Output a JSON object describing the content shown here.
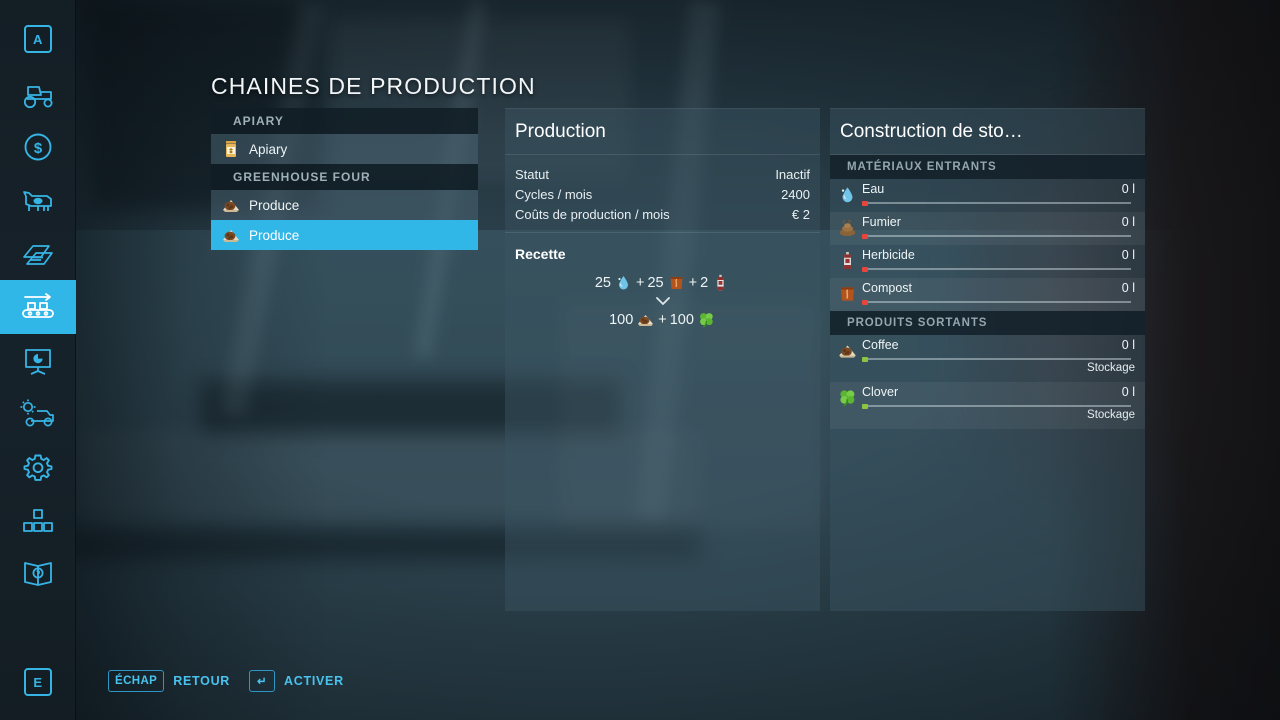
{
  "page": {
    "title": "CHAINES DE PRODUCTION"
  },
  "sidebar": {
    "items": [
      {
        "name": "map-key-a",
        "label": "A",
        "type": "key"
      },
      {
        "name": "vehicles-icon",
        "label": "",
        "type": "icon"
      },
      {
        "name": "finances-icon",
        "label": "",
        "type": "icon"
      },
      {
        "name": "animals-icon",
        "label": "",
        "type": "icon"
      },
      {
        "name": "contracts-icon",
        "label": "",
        "type": "icon"
      },
      {
        "name": "production-icon",
        "label": "",
        "type": "icon"
      },
      {
        "name": "statistics-icon",
        "label": "",
        "type": "icon"
      },
      {
        "name": "vehicle-config-icon",
        "label": "",
        "type": "icon"
      },
      {
        "name": "settings-icon",
        "label": "",
        "type": "icon"
      },
      {
        "name": "construction-icon",
        "label": "",
        "type": "icon"
      },
      {
        "name": "help-icon",
        "label": "",
        "type": "icon"
      },
      {
        "name": "map-key-e",
        "label": "E",
        "type": "key"
      }
    ],
    "active_index": 5,
    "accent": "#31b6e8"
  },
  "chain_list": [
    {
      "kind": "header",
      "label": "APIARY"
    },
    {
      "kind": "row",
      "label": "Apiary",
      "icon": "honey-jar-icon",
      "selected": false
    },
    {
      "kind": "header",
      "label": "GREENHOUSE FOUR"
    },
    {
      "kind": "row",
      "label": "Produce",
      "icon": "produce-icon",
      "selected": false
    },
    {
      "kind": "row",
      "label": "Produce",
      "icon": "produce-icon",
      "selected": true
    }
  ],
  "production": {
    "title": "Production",
    "stats": [
      {
        "label": "Statut",
        "value": "Inactif"
      },
      {
        "label": "Cycles / mois",
        "value": "2400"
      },
      {
        "label": "Coûts de production / mois",
        "value": "€ 2"
      }
    ],
    "recipe_title": "Recette",
    "recipe": {
      "inputs": [
        {
          "amount": "25",
          "icon": "water-drop-icon"
        },
        {
          "amount": "25",
          "icon": "compost-icon"
        },
        {
          "amount": "2",
          "icon": "herbicide-icon"
        }
      ],
      "outputs": [
        {
          "amount": "100",
          "icon": "coffee-icon"
        },
        {
          "amount": "100",
          "icon": "clover-icon"
        }
      ],
      "plus": "+",
      "arrow": "⌄"
    }
  },
  "storage": {
    "title": "Construction de sto…",
    "groups": [
      {
        "label": "MATÉRIAUX ENTRANTS",
        "rows": [
          {
            "name": "Eau",
            "amount": "0 l",
            "icon": "water-drop-icon",
            "dot": "#e8463c",
            "fill": 0,
            "sub": ""
          },
          {
            "name": "Fumier",
            "amount": "0 l",
            "icon": "manure-icon",
            "dot": "#e8463c",
            "fill": 0,
            "sub": ""
          },
          {
            "name": "Herbicide",
            "amount": "0 l",
            "icon": "herbicide-icon",
            "dot": "#e8463c",
            "fill": 0,
            "sub": ""
          },
          {
            "name": "Compost",
            "amount": "0 l",
            "icon": "compost-icon",
            "dot": "#e8463c",
            "fill": 0,
            "sub": ""
          }
        ]
      },
      {
        "label": "PRODUITS SORTANTS",
        "rows": [
          {
            "name": "Coffee",
            "amount": "0 l",
            "icon": "coffee-icon",
            "dot": "#8cc63f",
            "fill": 0,
            "sub": "Stockage"
          },
          {
            "name": "Clover",
            "amount": "0 l",
            "icon": "clover-icon",
            "dot": "#8cc63f",
            "fill": 0,
            "sub": "Stockage"
          }
        ]
      }
    ]
  },
  "helpbar": [
    {
      "key": "ÉCHAP",
      "label": "RETOUR"
    },
    {
      "key": "↵",
      "label": "ACTIVER"
    }
  ]
}
